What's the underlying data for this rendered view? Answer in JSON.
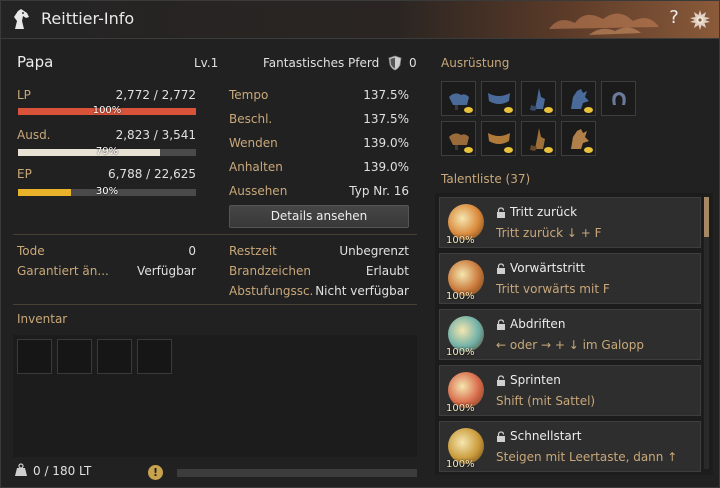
{
  "window": {
    "title": "Reittier-Info"
  },
  "pet": {
    "name": "Papa",
    "level": "Lv.1",
    "grade": "Fantastisches Pferd",
    "count": "0"
  },
  "bars": [
    {
      "label": "LP",
      "value": "2,772 / 2,772",
      "percent": "100%",
      "fraction": 1.0,
      "color": "#d8533a"
    },
    {
      "label": "Ausd.",
      "value": "2,823 / 3,541",
      "percent": "79%",
      "fraction": 0.797,
      "color": "#e8e2d4"
    },
    {
      "label": "EP",
      "value": "6,788 / 22,625",
      "percent": "30%",
      "fraction": 0.3,
      "color": "#e8b22a"
    }
  ],
  "speed_stats": [
    {
      "label": "Tempo",
      "value": "137.5%"
    },
    {
      "label": "Beschl.",
      "value": "137.5%"
    },
    {
      "label": "Wenden",
      "value": "139.0%"
    },
    {
      "label": "Anhalten",
      "value": "139.0%"
    },
    {
      "label": "Aussehen",
      "value": "Typ Nr. 16"
    }
  ],
  "details_button": "Details ansehen",
  "left_info": [
    {
      "label": "Tode",
      "value": "0"
    },
    {
      "label": "Garantiert än...",
      "value": "Verfügbar"
    }
  ],
  "right_info": [
    {
      "label": "Restzeit",
      "value": "Unbegrenzt"
    },
    {
      "label": "Brandzeichen",
      "value": "Erlaubt"
    },
    {
      "label": "Abstufungssc.",
      "value": "Nicht verfügbar"
    }
  ],
  "inventory": {
    "title": "Inventar",
    "weight": "0 / 180 LT",
    "warning": "!"
  },
  "equipment": {
    "title": "Ausrüstung",
    "row1": [
      "saddle-icon",
      "barding-icon",
      "stirrup-icon",
      "horse-armor-icon",
      "horseshoe-icon"
    ],
    "row2": [
      "saddle-icon",
      "barding-icon",
      "stirrup-icon",
      "horse-armor-icon"
    ]
  },
  "talents": {
    "title": "Talentliste (37)",
    "items": [
      {
        "name": "Tritt zurück",
        "desc": "Tritt zurück ↓ + F",
        "percent": "100%",
        "color": "#d9883a"
      },
      {
        "name": "Vorwärtstritt",
        "desc": "Tritt vorwärts mit F",
        "percent": "100%",
        "color": "#c9783a"
      },
      {
        "name": "Abdriften",
        "desc": "← oder → + ↓ im Galopp",
        "percent": "100%",
        "color": "#6fb0a8"
      },
      {
        "name": "Sprinten",
        "desc": "Shift (mit Sattel)",
        "percent": "100%",
        "color": "#d86a4a"
      },
      {
        "name": "Schnellstart",
        "desc": "Steigen mit Leertaste, dann ↑",
        "percent": "100%",
        "color": "#c99a3a"
      }
    ]
  }
}
